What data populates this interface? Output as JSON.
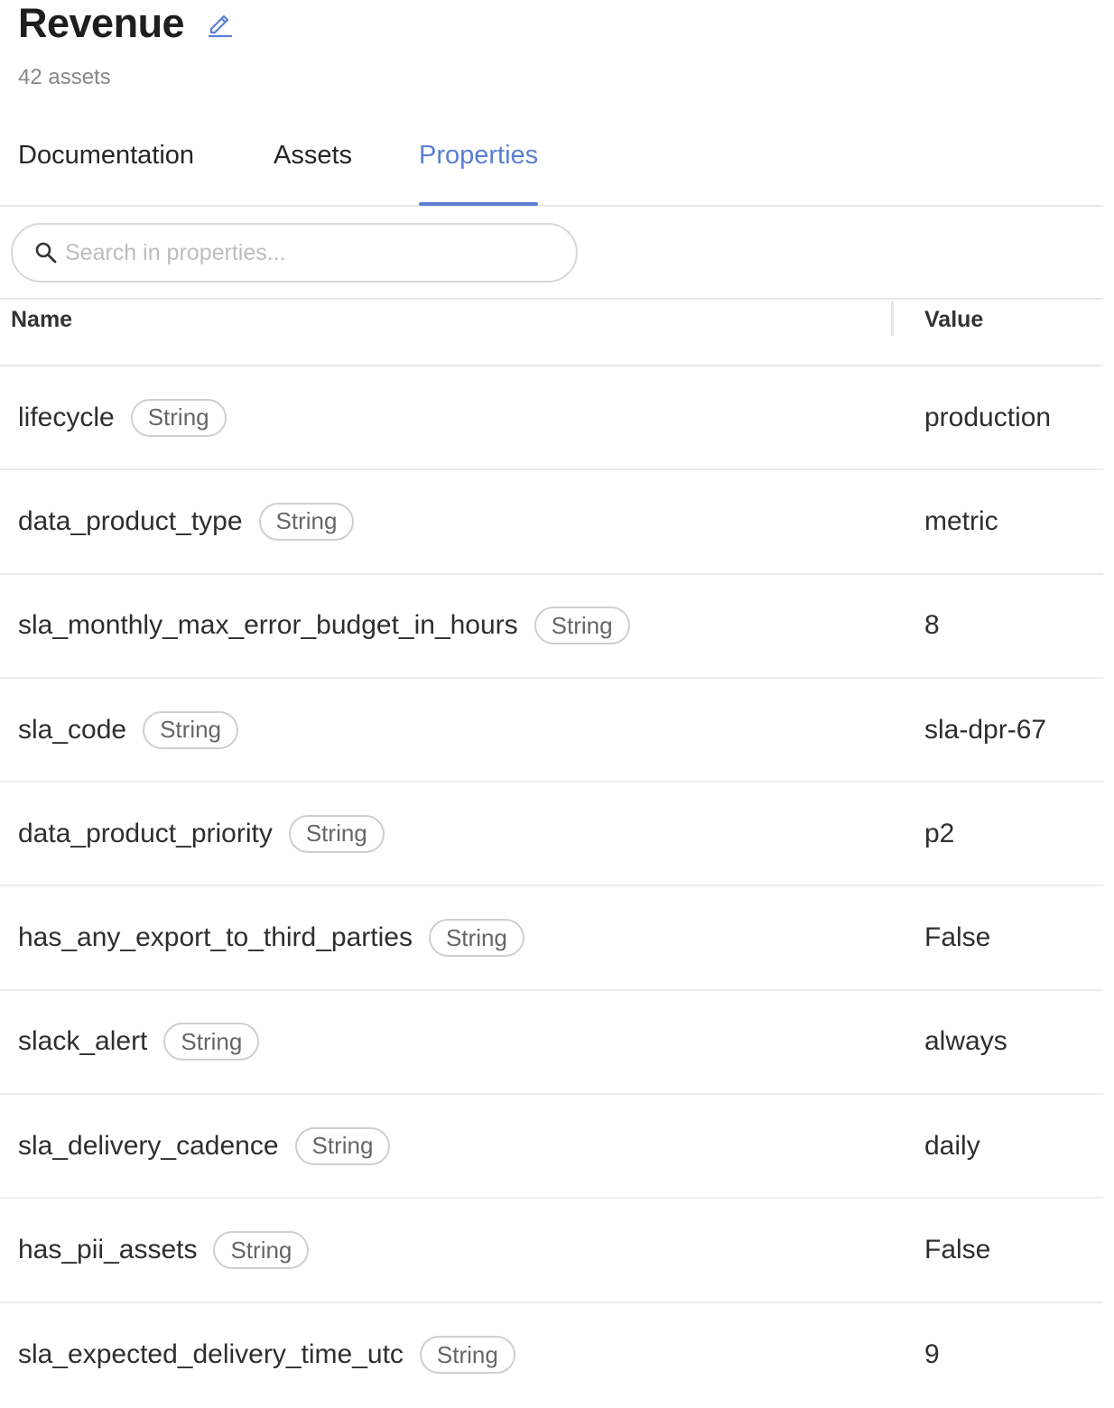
{
  "header": {
    "title": "Revenue",
    "asset_count": "42 assets"
  },
  "tabs": [
    {
      "label": "Documentation",
      "active": false
    },
    {
      "label": "Assets",
      "active": false
    },
    {
      "label": "Properties",
      "active": true
    }
  ],
  "search": {
    "placeholder": "Search in properties...",
    "value": ""
  },
  "table": {
    "columns": [
      "Name",
      "Value"
    ],
    "rows": [
      {
        "name": "lifecycle",
        "type": "String",
        "value": "production"
      },
      {
        "name": "data_product_type",
        "type": "String",
        "value": "metric"
      },
      {
        "name": "sla_monthly_max_error_budget_in_hours",
        "type": "String",
        "value": "8"
      },
      {
        "name": "sla_code",
        "type": "String",
        "value": "sla-dpr-67"
      },
      {
        "name": "data_product_priority",
        "type": "String",
        "value": "p2"
      },
      {
        "name": "has_any_export_to_third_parties",
        "type": "String",
        "value": "False"
      },
      {
        "name": "slack_alert",
        "type": "String",
        "value": "always"
      },
      {
        "name": "sla_delivery_cadence",
        "type": "String",
        "value": "daily"
      },
      {
        "name": "has_pii_assets",
        "type": "String",
        "value": "False"
      },
      {
        "name": "sla_expected_delivery_time_utc",
        "type": "String",
        "value": "9"
      }
    ]
  },
  "colors": {
    "accent": "#5b7fd1",
    "text": "#2e2e2e",
    "muted": "#888888",
    "border": "#ececec"
  },
  "icons": {
    "edit": "pencil-icon",
    "search": "search-icon"
  }
}
